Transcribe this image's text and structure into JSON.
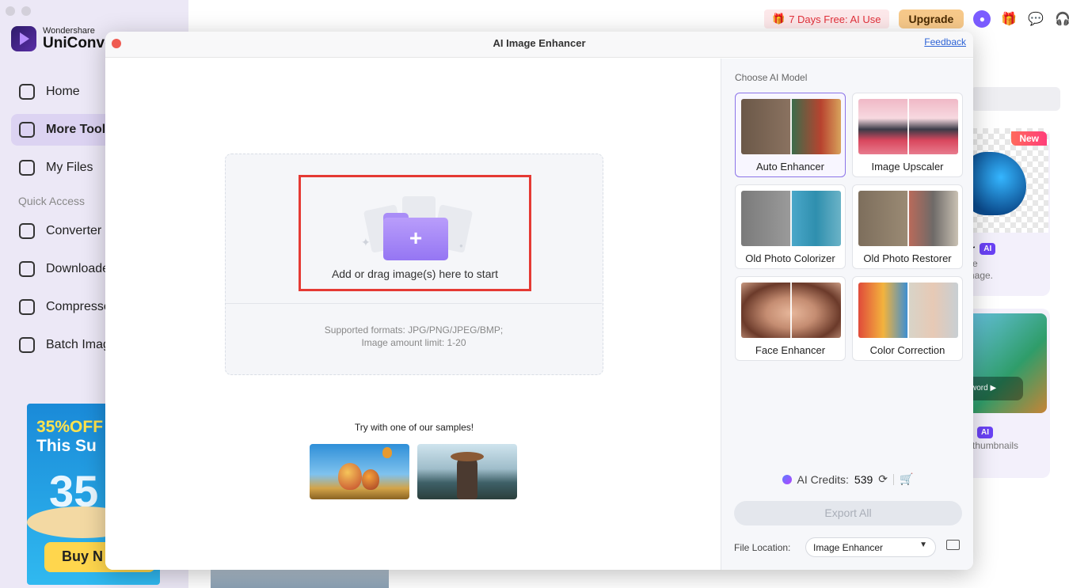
{
  "app": {
    "brand_small": "Wondershare",
    "brand_big": "UniConve",
    "nav": [
      {
        "label": "Home",
        "icon": "home-icon"
      },
      {
        "label": "More Tool",
        "icon": "toolbox-icon"
      },
      {
        "label": "My Files",
        "icon": "files-icon"
      }
    ],
    "quick_access_label": "Quick Access",
    "quick_items": [
      {
        "label": "Converter",
        "icon": "converter-icon"
      },
      {
        "label": "Downloade",
        "icon": "download-icon"
      },
      {
        "label": "Compresse",
        "icon": "compress-icon"
      },
      {
        "label": "Batch Imag",
        "icon": "batch-image-icon"
      }
    ],
    "promo": {
      "line1": "35%OFF",
      "line2": "This Su",
      "big": "35",
      "button": "Buy N"
    }
  },
  "topbar": {
    "free_label": "7 Days Free: AI Use",
    "upgrade_label": "Upgrade"
  },
  "bg_cards": {
    "new_badge": "New",
    "card1_name": "er",
    "card1_ai": "AI",
    "card1_desc1": "the",
    "card1_desc2": "image.",
    "card2_play": "word",
    "card2_ai": "AI",
    "card2_desc": "d thumbnails"
  },
  "modal": {
    "title": "AI Image Enhancer",
    "feedback": "Feedback",
    "drop_text": "Add or drag image(s) here to start",
    "formats_line1": "Supported formats: JPG/PNG/JPEG/BMP;",
    "formats_line2": "Image amount limit: 1-20",
    "try_label": "Try with one of our samples!",
    "choose_label": "Choose AI Model",
    "models": [
      {
        "name": "Auto Enhancer",
        "selected": true
      },
      {
        "name": "Image Upscaler",
        "selected": false
      },
      {
        "name": "Old Photo Colorizer",
        "selected": false
      },
      {
        "name": "Old Photo Restorer",
        "selected": false
      },
      {
        "name": "Face Enhancer",
        "selected": false
      },
      {
        "name": "Color Correction",
        "selected": false
      }
    ],
    "credits_label": "AI Credits:",
    "credits_value": "539",
    "export_label": "Export All",
    "location_label": "File Location:",
    "location_value": "Image Enhancer"
  },
  "colors": {
    "accent": "#6a42f5",
    "highlight_box": "#e53a34",
    "folder": "#9f84f6"
  }
}
